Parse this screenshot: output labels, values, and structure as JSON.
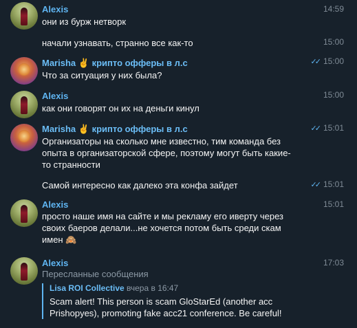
{
  "messages": [
    {
      "author": "Alexis",
      "lines": [
        "они из бурж нетворк"
      ],
      "time": "14:59"
    },
    {
      "author": "",
      "lines": [
        "начали узнавать, странно все как-то"
      ],
      "time": "15:00"
    },
    {
      "author": "Marisha",
      "author_suffix": "крипто офферы в л.с",
      "author_emoji": "✌️",
      "lines": [
        "Что за ситуация у них была?"
      ],
      "time": "15:00",
      "read": true
    },
    {
      "author": "Alexis",
      "lines": [
        "как они говорят он их на деньги кинул"
      ],
      "time": "15:00"
    },
    {
      "author": "Marisha",
      "author_suffix": "крипто офферы в л.с",
      "author_emoji": "✌️",
      "lines": [
        "Организаторы на сколько мне известно, тим команда без",
        "опыта в организаторской сфере, поэтому могут быть какие-",
        "то странности"
      ],
      "time": "15:01",
      "read": true
    },
    {
      "author": "",
      "lines": [
        "Самой интересно как далеко эта конфа зайдет"
      ],
      "time": "15:01",
      "read": true
    },
    {
      "author": "Alexis",
      "lines": [
        "просто наше имя на сайте и мы рекламу его иверту через",
        "своих баеров делали...не хочется потом быть среди скам",
        "имен"
      ],
      "line_emoji": "🙈",
      "time": "15:01"
    },
    {
      "author": "Alexis",
      "forward_label": "Пересланные сообщения",
      "forward": {
        "source": "Lisa ROI Collective",
        "when": "вчера в 16:47",
        "lines": [
          "Scam alert! This person is scam GloStarEd (another acc",
          "Prishopyes), promoting fake acc21 conference. Be careful!"
        ]
      },
      "time": "17:03"
    }
  ],
  "check_glyph": "✓✓"
}
